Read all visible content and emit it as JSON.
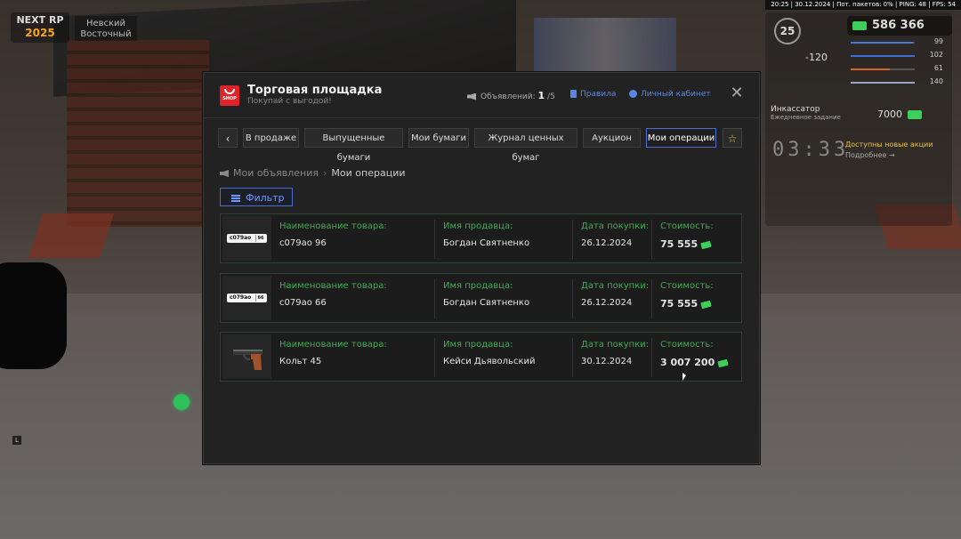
{
  "hud": {
    "logo_top": "NEXT RP",
    "logo_year": "2025",
    "server": "Невский Восточный",
    "stats": "20:25 | 30.12.2024 | Пот. пакетов: 0% | PING: 48 | FPS: 54",
    "money": "586 366",
    "level": "25",
    "value_neg": "-120",
    "bars": [
      {
        "value": "99",
        "color": "#4a7bd0"
      },
      {
        "value": "102",
        "color": "#3b6fd6"
      },
      {
        "value": "61",
        "color": "#d9652b"
      },
      {
        "value": "140",
        "color": "#9aa6c8"
      }
    ],
    "task_title": "Инкассатор",
    "task_sub": "Ежедневное задание",
    "task_reward": "7000",
    "timer": "03:33",
    "promo": "Доступны новые акции",
    "promo_more": "Подробнее →",
    "key_hint": "L"
  },
  "window": {
    "title": "Торговая площадка",
    "subtitle": "Покупай с выгодой!",
    "shop_badge": "SHOP",
    "ads_label": "Объявлений:",
    "ads_count": "1",
    "ads_max": "/5",
    "rules": "Правила",
    "cabinet": "Личный кабинет",
    "close_icon": "✕"
  },
  "tabs": {
    "back": "‹",
    "items": [
      "В продаже",
      "Выпущенные бумаги",
      "Мои бумаги",
      "Журнал ценных бумаг",
      "Аукцион",
      "Мои операции"
    ],
    "active_index": 5,
    "star": "☆"
  },
  "breadcrumb": {
    "parent": "Мои объявления",
    "sep": "›",
    "current": "Мои операции"
  },
  "filter_label": "Фильтр",
  "columns": {
    "item": "Наименование товара:",
    "seller": "Имя продавца:",
    "date": "Дата покупки:",
    "price": "Стоимость:"
  },
  "rows": [
    {
      "thumb": "plate",
      "plate_text": "c079ao",
      "plate_region": "96",
      "item": "с079ао 96",
      "seller": "Богдан Святненко",
      "date": "26.12.2024",
      "price": "75 555"
    },
    {
      "thumb": "plate",
      "plate_text": "c079ao",
      "plate_region": "66",
      "item": "с079ао 66",
      "seller": "Богдан Святненко",
      "date": "26.12.2024",
      "price": "75 555"
    },
    {
      "thumb": "pistol-icon",
      "item": "Кольт 45",
      "seller": "Кейси Дьявольский",
      "date": "30.12.2024",
      "price": "3 007 200"
    }
  ],
  "colors": {
    "accent_blue": "#4a6fd0",
    "label_green": "#3fae4f",
    "shop_red": "#e0222a"
  }
}
